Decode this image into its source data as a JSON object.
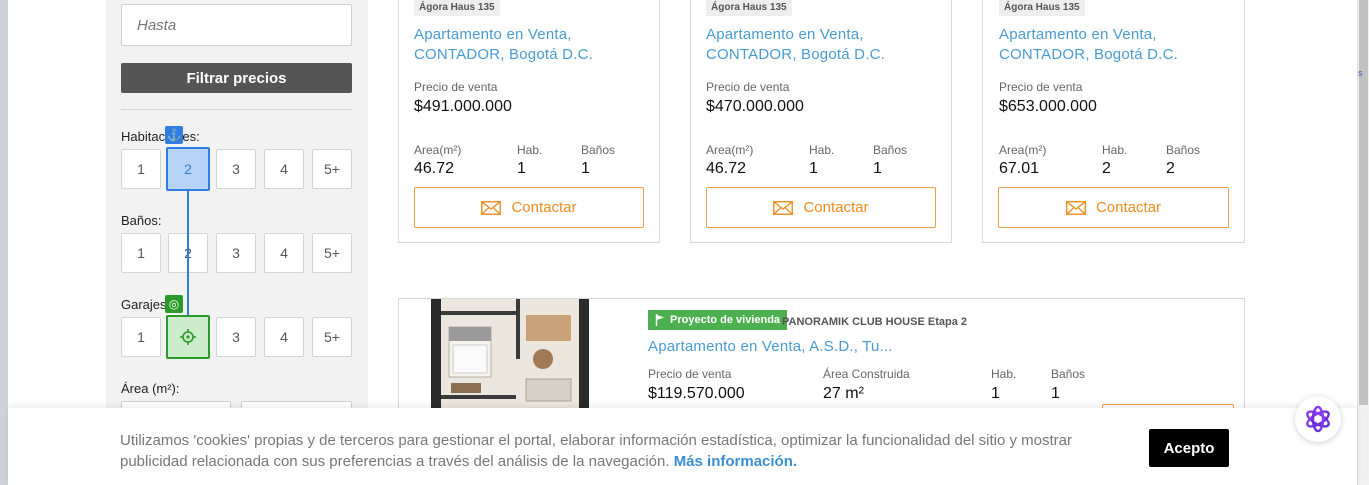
{
  "sidebar": {
    "price_max_placeholder": "Hasta",
    "filter_button": "Filtrar precios",
    "bedrooms_label": "Habitaciones:",
    "bathrooms_label": "Baños:",
    "garages_label": "Garajes:",
    "area_label": "Área (m²):",
    "options": [
      "1",
      "2",
      "3",
      "4",
      "5+"
    ]
  },
  "cards": [
    {
      "project": "Ágora Haus 135",
      "title_line1": "Apartamento en Venta,",
      "title_line2": "CONTADOR, Bogotá D.C.",
      "price_label": "Precio de venta",
      "price": "$491.000.000",
      "area_label": "Area(m²)",
      "area": "46.72",
      "hab_label": "Hab.",
      "hab": "1",
      "banos_label": "Baños",
      "banos": "1",
      "contact": "Contactar"
    },
    {
      "project": "Ágora Haus 135",
      "title_line1": "Apartamento en Venta,",
      "title_line2": "CONTADOR, Bogotá D.C.",
      "price_label": "Precio de venta",
      "price": "$470.000.000",
      "area_label": "Area(m²)",
      "area": "46.72",
      "hab_label": "Hab.",
      "hab": "1",
      "banos_label": "Baños",
      "banos": "1",
      "contact": "Contactar"
    },
    {
      "project": "Ágora Haus 135",
      "title_line1": "Apartamento en Venta,",
      "title_line2": "CONTADOR, Bogotá D.C.",
      "price_label": "Precio de venta",
      "price": "$653.000.000",
      "area_label": "Area(m²)",
      "area": "67.01",
      "hab_label": "Hab.",
      "hab": "2",
      "banos_label": "Baños",
      "banos": "2",
      "contact": "Contactar"
    }
  ],
  "featured": {
    "badge": "Proyecto de vivienda",
    "project": "PANORAMIK CLUB HOUSE Etapa 2",
    "title": "Apartamento en Venta, A.S.D., Tu...",
    "price_label": "Precio de venta",
    "price": "$119.570.000",
    "area_label": "Área Construida",
    "area": "27 m²",
    "hab_label": "Hab.",
    "hab": "1",
    "banos_label": "Baños",
    "banos": "1"
  },
  "cookie": {
    "text": "Utilizamos 'cookies' propias y de terceros para gestionar el portal, elaborar información estadística, optimizar la funcionalidad del sitio y mostrar publicidad relacionada con sus preferencias a través del análisis de la navegación.",
    "link": "Más información.",
    "accept": "Acepto"
  },
  "edge_text": "s",
  "colors": {
    "accent_orange": "#f08c1e",
    "link_blue": "#4a9bd1",
    "vivienda_green": "#4caf50",
    "selected_blue": "#2f7de1",
    "selected_green": "#2a9a2a"
  }
}
